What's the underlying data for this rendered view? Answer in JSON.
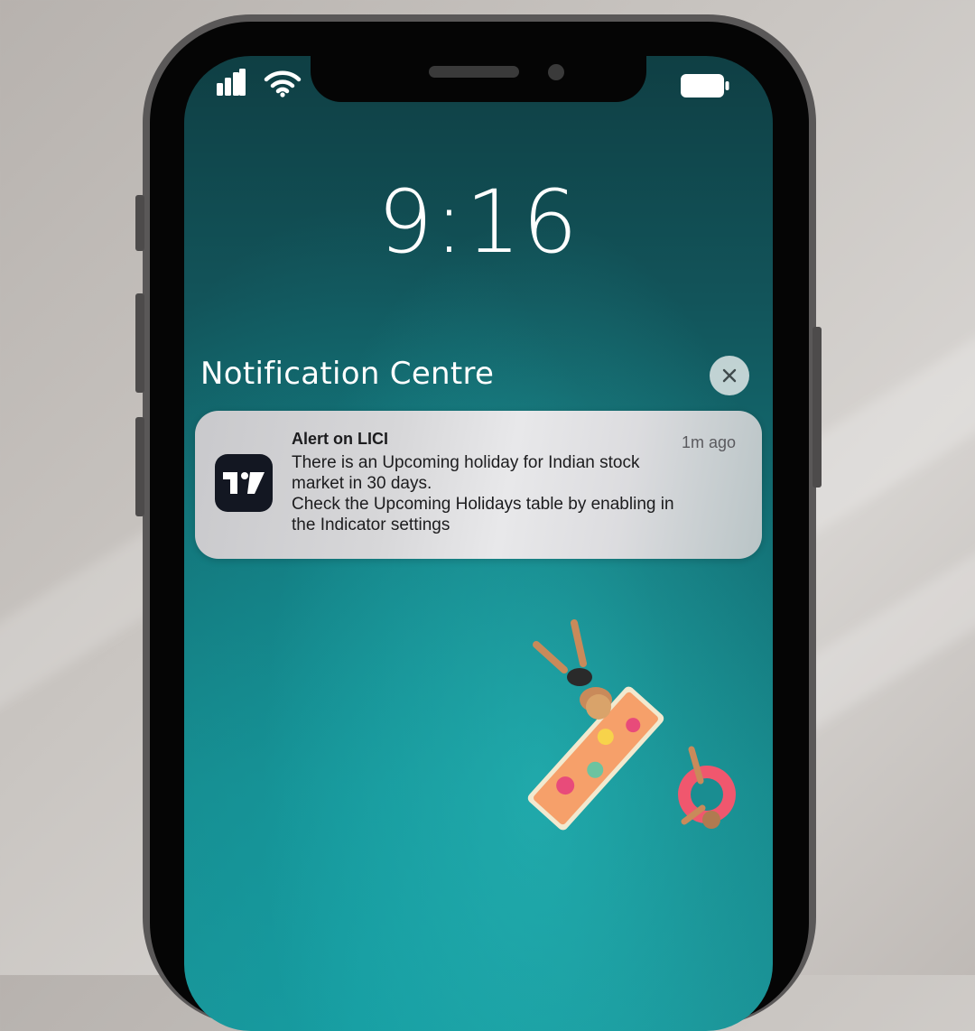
{
  "status_bar": {
    "signal_icon": "cellular-signal-icon",
    "wifi_icon": "wifi-icon",
    "battery_icon": "battery-icon"
  },
  "lock_screen": {
    "time": "9:16"
  },
  "notification_centre": {
    "title": "Notification Centre",
    "close_icon": "close-icon"
  },
  "notification": {
    "app_icon": "tradingview-app-icon",
    "title": "Alert on LICI",
    "timestamp": "1m ago",
    "body_lines": [
      "There is an Upcoming holiday for Indian stock",
      "market in 30 days.",
      "Check the Upcoming Holidays table by enabling in",
      "the Indicator settings"
    ]
  },
  "colors": {
    "screen_accent": "#17888b",
    "card_background": "#dcdcdf",
    "app_icon_background": "#131722"
  }
}
